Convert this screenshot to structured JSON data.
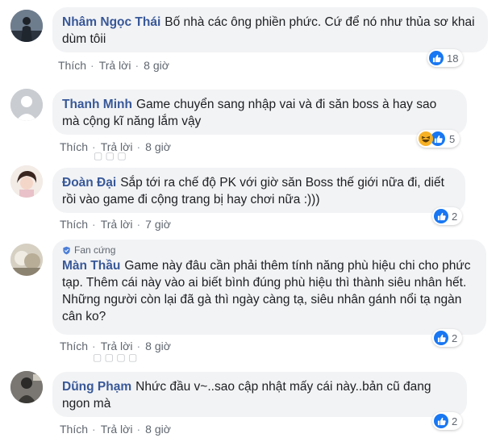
{
  "action_like": "Thích",
  "action_reply": "Trả lời",
  "separator": "·",
  "comments": [
    {
      "author": "Nhâm Ngọc Thái",
      "text": "Bố nhà các ông phiền phức. Cứ để nó như thủa sơ khai dùm tôii",
      "time": "8 giờ",
      "reactions": {
        "types": [
          "like"
        ],
        "count": "18"
      }
    },
    {
      "author": "Thanh Minh",
      "text": "Game chuyển sang nhập vai và đi săn boss à hay sao mà cộng kĩ năng lắm vậy",
      "time": "8 giờ",
      "reactions": {
        "types": [
          "haha",
          "like"
        ],
        "count": "5"
      }
    },
    {
      "author": "Đoàn Đại",
      "text": "Sắp tới ra chế độ PK với giờ săn Boss thế giới nữa đi, diết rồi vào game đi cộng trang bị hay chơi nữa :)))",
      "time": "7 giờ",
      "reactions": {
        "types": [
          "like"
        ],
        "count": "2"
      }
    },
    {
      "badge": "Fan cứng",
      "author": "Màn Thầu",
      "text": "Game này đâu cần phải thêm tính năng phù hiệu chi cho phức tạp. Thêm cái này vào ai biết bình đúng phù hiệu thì thành siêu nhân hết. Những người còn lại đã gà thì ngày càng tạ, siêu nhân gánh nổi tạ ngàn cân ko?",
      "time": "8 giờ",
      "reactions": {
        "types": [
          "like"
        ],
        "count": "2"
      }
    },
    {
      "author": "Dũng Phạm",
      "text": "Nhức đầu v~..sao cập nhật mấy cái này..bản cũ đang ngon mà",
      "time": "8 giờ",
      "reactions": {
        "types": [
          "like"
        ],
        "count": "2"
      }
    }
  ],
  "colors": {
    "author": "#385898",
    "bubble": "#f2f3f5",
    "like_blue": "#1877f2",
    "haha_yellow": "#f7b125",
    "meta": "#606770"
  }
}
